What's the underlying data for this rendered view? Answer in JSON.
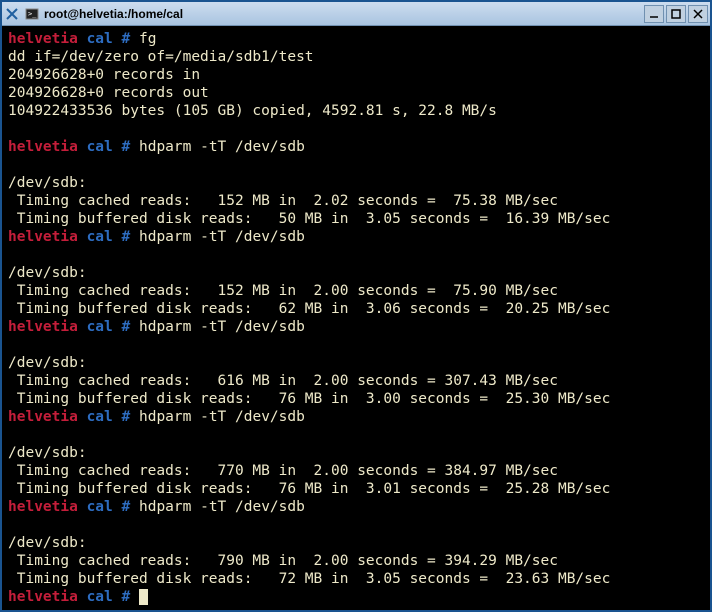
{
  "window": {
    "title": "root@helvetia:/home/cal"
  },
  "prompt": {
    "host": "helvetia",
    "dir": "cal",
    "hash": "#"
  },
  "blocks": [
    {
      "cmd": "fg",
      "output": [
        "dd if=/dev/zero of=/media/sdb1/test",
        "204926628+0 records in",
        "204926628+0 records out",
        "104922433536 bytes (105 GB) copied, 4592.81 s, 22.8 MB/s",
        ""
      ]
    },
    {
      "cmd": "hdparm -tT /dev/sdb",
      "output": [
        "",
        "/dev/sdb:",
        " Timing cached reads:   152 MB in  2.02 seconds =  75.38 MB/sec",
        " Timing buffered disk reads:   50 MB in  3.05 seconds =  16.39 MB/sec"
      ]
    },
    {
      "cmd": "hdparm -tT /dev/sdb",
      "output": [
        "",
        "/dev/sdb:",
        " Timing cached reads:   152 MB in  2.00 seconds =  75.90 MB/sec",
        " Timing buffered disk reads:   62 MB in  3.06 seconds =  20.25 MB/sec"
      ]
    },
    {
      "cmd": "hdparm -tT /dev/sdb",
      "output": [
        "",
        "/dev/sdb:",
        " Timing cached reads:   616 MB in  2.00 seconds = 307.43 MB/sec",
        " Timing buffered disk reads:   76 MB in  3.00 seconds =  25.30 MB/sec"
      ]
    },
    {
      "cmd": "hdparm -tT /dev/sdb",
      "output": [
        "",
        "/dev/sdb:",
        " Timing cached reads:   770 MB in  2.00 seconds = 384.97 MB/sec",
        " Timing buffered disk reads:   76 MB in  3.01 seconds =  25.28 MB/sec"
      ]
    },
    {
      "cmd": "hdparm -tT /dev/sdb",
      "output": [
        "",
        "/dev/sdb:",
        " Timing cached reads:   790 MB in  2.00 seconds = 394.29 MB/sec",
        " Timing buffered disk reads:   72 MB in  3.05 seconds =  23.63 MB/sec"
      ]
    }
  ]
}
